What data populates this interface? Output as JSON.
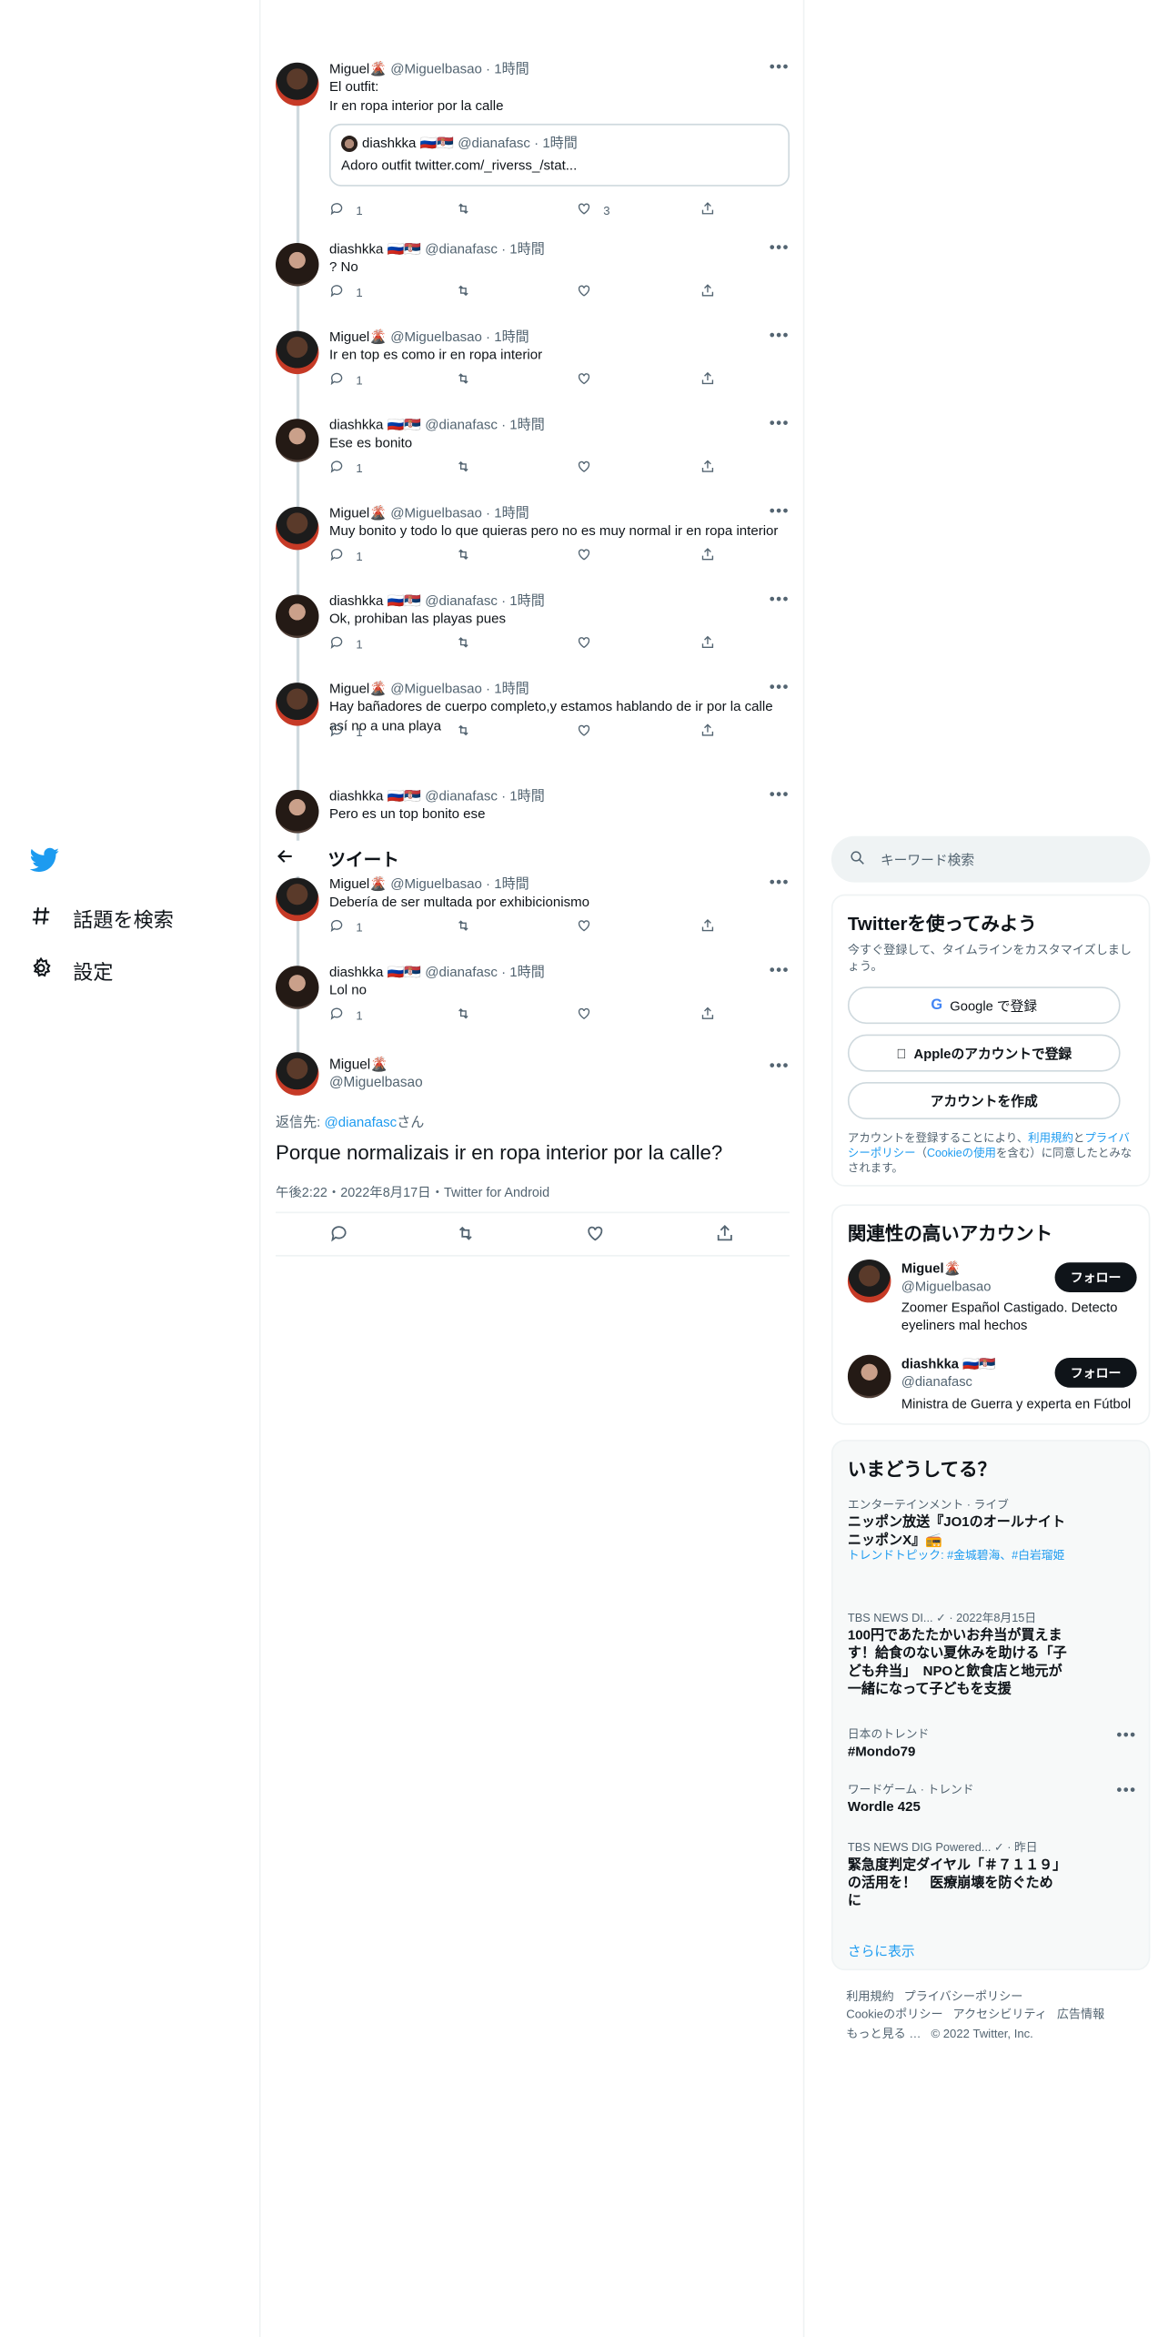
{
  "nav": {
    "explore": "話題を検索",
    "settings": "設定"
  },
  "header": {
    "title": "ツイート"
  },
  "thread": [
    {
      "name": "Miguel🌋",
      "handle": "@Miguelbasao",
      "time": "· 1時間",
      "text": "El outfit:\nIr en ropa interior por la calle",
      "quote": {
        "name": "diashkka 🇷🇺🇷🇸",
        "handle": "@dianafasc",
        "time": "· 1時間",
        "text": "Adoro outfit twitter.com/_riverss_/stat..."
      },
      "replies": "1",
      "likes": "3"
    },
    {
      "name": "diashkka 🇷🇺🇷🇸",
      "handle": "@dianafasc",
      "time": "· 1時間",
      "text": "? No",
      "replies": "1",
      "likes": ""
    },
    {
      "name": "Miguel🌋",
      "handle": "@Miguelbasao",
      "time": "· 1時間",
      "text": "Ir en top es como ir en ropa interior",
      "replies": "1",
      "likes": ""
    },
    {
      "name": "diashkka 🇷🇺🇷🇸",
      "handle": "@dianafasc",
      "time": "· 1時間",
      "text": "Ese es bonito",
      "replies": "1",
      "likes": ""
    },
    {
      "name": "Miguel🌋",
      "handle": "@Miguelbasao",
      "time": "· 1時間",
      "text": "Muy bonito y todo lo que quieras pero no es muy normal ir en ropa interior",
      "replies": "1",
      "likes": ""
    },
    {
      "name": "diashkka 🇷🇺🇷🇸",
      "handle": "@dianafasc",
      "time": "· 1時間",
      "text": "Ok, prohiban las playas pues",
      "replies": "1",
      "likes": ""
    },
    {
      "name": "Miguel🌋",
      "handle": "@Miguelbasao",
      "time": "· 1時間",
      "text": "Hay bañadores de cuerpo completo,y estamos hablando de ir por la calle así no a una playa",
      "replies": "1",
      "likes": ""
    },
    {
      "name": "diashkka 🇷🇺🇷🇸",
      "handle": "@dianafasc",
      "time": "· 1時間",
      "text": "Pero es un top bonito ese",
      "replies": "",
      "likes": ""
    },
    {
      "name": "Miguel🌋",
      "handle": "@Miguelbasao",
      "time": "· 1時間",
      "text": "Debería de ser multada por exhibicionismo",
      "replies": "1",
      "likes": ""
    },
    {
      "name": "diashkka 🇷🇺🇷🇸",
      "handle": "@dianafasc",
      "time": "· 1時間",
      "text": "Lol no",
      "replies": "1",
      "likes": ""
    }
  ],
  "focus": {
    "name": "Miguel🌋",
    "handle": "@Miguelbasao",
    "reply_prefix": "返信先: ",
    "reply_to": "@dianafasc",
    "reply_suffix": "さん",
    "text": "Porque normalizais ir en ropa interior por la calle?",
    "meta": "午後2:22・2022年8月17日・Twitter for Android"
  },
  "search": {
    "placeholder": "キーワード検索"
  },
  "signup": {
    "title": "Twitterを使ってみよう",
    "desc": "今すぐ登録して、タイムラインをカスタマイズしましょう。",
    "google": "Google で登録",
    "apple": "Appleのアカウントで登録",
    "create": "アカウントを作成",
    "legal_1": "アカウントを登録することにより、",
    "legal_terms": "利用規約",
    "legal_2": "と",
    "legal_privacy": "プライバシーポリシー",
    "legal_3": "（",
    "legal_cookie": "Cookieの使用",
    "legal_4": "を含む）に同意したとみなされます。"
  },
  "related": {
    "title": "関連性の高いアカウント",
    "accounts": [
      {
        "name": "Miguel🌋",
        "handle": "@Miguelbasao",
        "bio": "Zoomer Español Castigado. Detecto eyeliners mal hechos",
        "follow": "フォロー"
      },
      {
        "name": "diashkka 🇷🇺🇷🇸",
        "handle": "@dianafasc",
        "bio": "Ministra de Guerra y experta en Fútbol",
        "follow": "フォロー"
      }
    ]
  },
  "trends": {
    "title": "いまどうしてる？",
    "items": [
      {
        "cat": "エンターテインメント · ライブ",
        "title": "ニッポン放送『JO1のオールナイトニッポンX』📻",
        "sub": "トレンドトピック: #金城碧海、#白岩瑠姫"
      },
      {
        "cat": "TBS NEWS DI... ✓ · 2022年8月15日",
        "title": "100円であたたかいお弁当が買えます！給食のない夏休みを助ける「子ども弁当」　NPOと飲食店と地元が一緒になって子どもを支援",
        "sub": ""
      },
      {
        "cat": "日本のトレンド",
        "title": "#Mondo79",
        "sub": ""
      },
      {
        "cat": "ワードゲーム · トレンド",
        "title": "Wordle 425",
        "sub": ""
      },
      {
        "cat": "TBS NEWS DIG Powered... ✓ · 昨日",
        "title": "緊急度判定ダイヤル「＃７１１９」の活用を！　医療崩壊を防ぐために",
        "sub": ""
      }
    ],
    "more": "さらに表示"
  },
  "footer": {
    "terms": "利用規約",
    "privacy": "プライバシーポリシー",
    "cookie": "Cookieのポリシー",
    "a11y": "アクセシビリティ",
    "ads": "広告情報",
    "more": "もっと見る …",
    "copy": "© 2022 Twitter, Inc."
  }
}
